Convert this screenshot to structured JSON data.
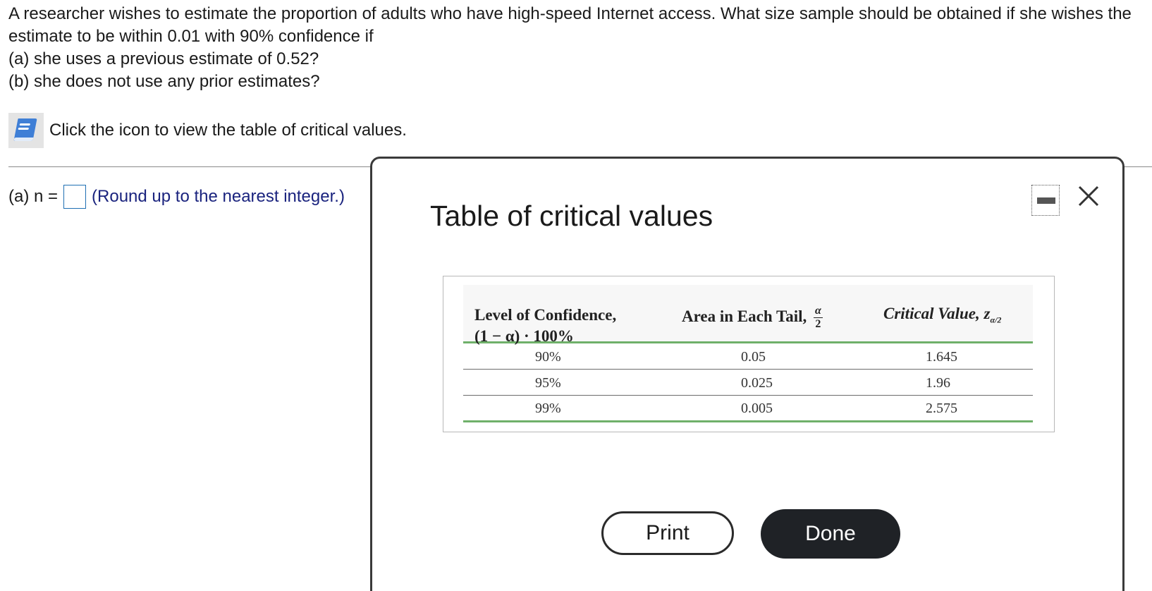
{
  "question": {
    "text": "A researcher wishes to estimate the proportion of adults who have high-speed Internet access. What size sample should be obtained if she wishes the estimate to be within 0.01 with 90% confidence if",
    "part_a": "(a) she uses a previous estimate of 0.52?",
    "part_b": "(b) she does not use any prior estimates?"
  },
  "hint": {
    "icon": "book-icon",
    "text": "Click the icon to view the table of critical values."
  },
  "answer": {
    "label": "(a) n =",
    "value": "",
    "hint": "(Round up to the nearest integer.)"
  },
  "modal": {
    "title": "Table of critical values",
    "minimize_icon": "minimize-icon",
    "close_icon": "close-icon",
    "table": {
      "headers": {
        "confidence_line1": "Level of Confidence,",
        "confidence_line2": "(1 − α) · 100%",
        "area": "Area in Each Tail,",
        "area_frac_num": "α",
        "area_frac_den": "2",
        "critical": "Critical Value, z",
        "critical_sub": "α/2"
      },
      "rows": [
        {
          "confidence": "90%",
          "area": "0.05",
          "critical": "1.645"
        },
        {
          "confidence": "95%",
          "area": "0.025",
          "critical": "1.96"
        },
        {
          "confidence": "99%",
          "area": "0.005",
          "critical": "2.575"
        }
      ]
    },
    "print_label": "Print",
    "done_label": "Done"
  },
  "colors": {
    "accent_green": "#6fb06a",
    "done_bg": "#1f2226",
    "input_border": "#1f6fb3",
    "hint_text": "#1a237e"
  }
}
